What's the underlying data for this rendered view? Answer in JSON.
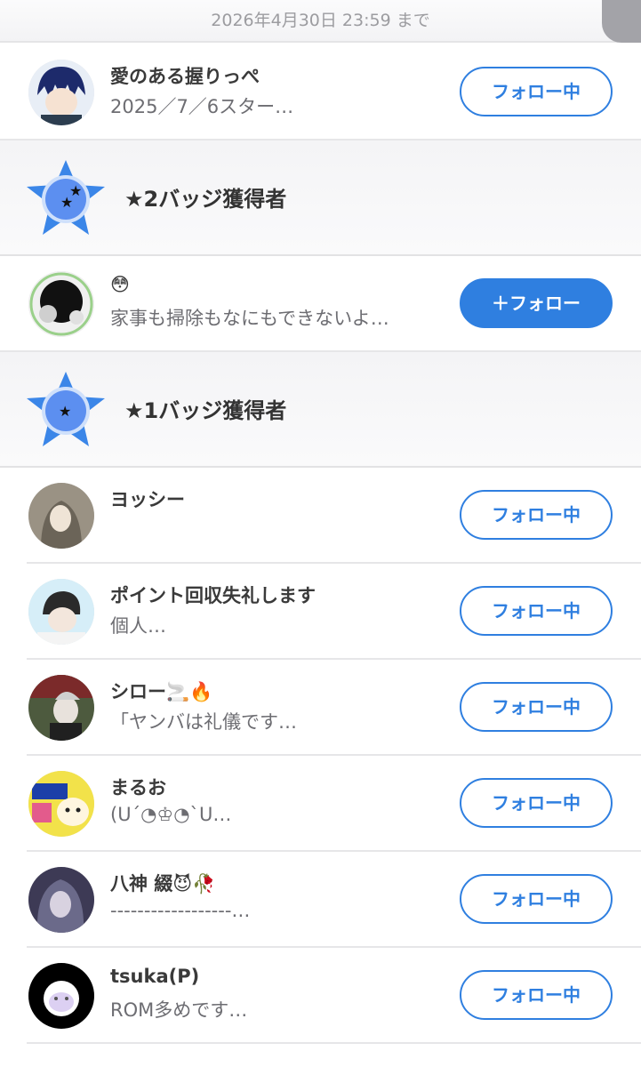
{
  "header": {
    "deadline": "2026年4月30日 23:59 まで"
  },
  "sections": [
    {
      "title": "★2バッジ獲得者",
      "stars": 2
    },
    {
      "title": "★1バッジ獲得者",
      "stars": 1
    }
  ],
  "users": [
    {
      "name": "愛のある握りっぺ",
      "sub": "2025／7／6スター…",
      "button": "フォロー中",
      "avatar_color": "#1d2a6b"
    },
    {
      "name": "😳",
      "sub": "家事も掃除もなにもできないよ…",
      "button": "＋フォロー",
      "avatar_color": "#222222"
    },
    {
      "name": "ヨッシー",
      "sub": "",
      "button": "フォロー中",
      "avatar_color": "#8c8476"
    },
    {
      "name": "ポイント回収失礼します",
      "sub": "個人…",
      "button": "フォロー中",
      "avatar_color": "#cfe9f5"
    },
    {
      "name": "シロー🚬🔥",
      "sub": "「ヤンバは礼儀です…",
      "button": "フォロー中",
      "avatar_color": "#5a6b4a"
    },
    {
      "name": "まるお",
      "sub": "(U´◔♔◔`U…",
      "button": "フォロー中",
      "avatar_color": "#f2e24a"
    },
    {
      "name": "八神 綴😈🥀",
      "sub": "‐‐‐‐‐‐‐‐‐‐‐‐‐‐‐‐‐‐…",
      "button": "フォロー中",
      "avatar_color": "#4a4560"
    },
    {
      "name": "tsuka(P)",
      "sub": "ROM多めです…",
      "button": "フォロー中",
      "avatar_color": "#000000"
    }
  ],
  "colors": {
    "accent": "#2f7fe0",
    "badge_blue": "#3b86e8"
  }
}
